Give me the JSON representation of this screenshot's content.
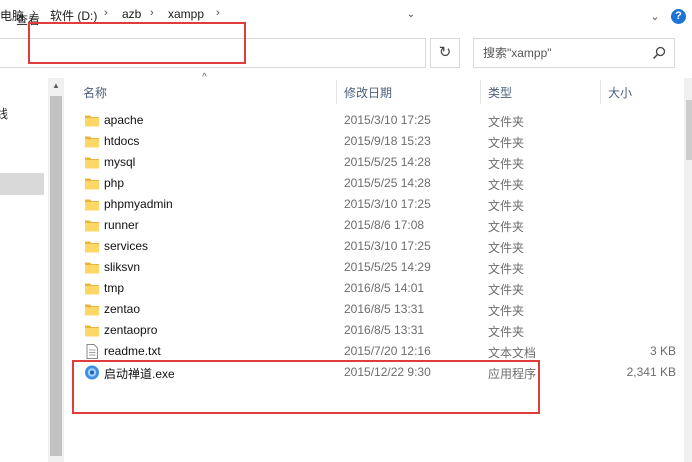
{
  "ribbon": {
    "tab_view": "查看",
    "expand_icon": "chevron-down-icon",
    "help_icon": "help-icon",
    "help_glyph": "?"
  },
  "address": {
    "crumbs": [
      "电脑",
      "软件 (D:)",
      "azb",
      "xampp"
    ],
    "separator": "›"
  },
  "search": {
    "placeholder": "搜索\"xampp\"",
    "icon": "search-icon"
  },
  "nav": {
    "partial_label": "线"
  },
  "columns": {
    "name": "名称",
    "date": "修改日期",
    "type": "类型",
    "size": "大小"
  },
  "files": [
    {
      "name": "apache",
      "date": "2015/3/10 17:25",
      "type": "文件夹",
      "size": "",
      "icon": "folder-icon"
    },
    {
      "name": "htdocs",
      "date": "2015/9/18 15:23",
      "type": "文件夹",
      "size": "",
      "icon": "folder-icon"
    },
    {
      "name": "mysql",
      "date": "2015/5/25 14:28",
      "type": "文件夹",
      "size": "",
      "icon": "folder-icon"
    },
    {
      "name": "php",
      "date": "2015/5/25 14:28",
      "type": "文件夹",
      "size": "",
      "icon": "folder-icon"
    },
    {
      "name": "phpmyadmin",
      "date": "2015/3/10 17:25",
      "type": "文件夹",
      "size": "",
      "icon": "folder-icon"
    },
    {
      "name": "runner",
      "date": "2015/8/6 17:08",
      "type": "文件夹",
      "size": "",
      "icon": "folder-icon"
    },
    {
      "name": "services",
      "date": "2015/3/10 17:25",
      "type": "文件夹",
      "size": "",
      "icon": "folder-icon"
    },
    {
      "name": "sliksvn",
      "date": "2015/5/25 14:29",
      "type": "文件夹",
      "size": "",
      "icon": "folder-icon"
    },
    {
      "name": "tmp",
      "date": "2016/8/5 14:01",
      "type": "文件夹",
      "size": "",
      "icon": "folder-icon"
    },
    {
      "name": "zentao",
      "date": "2016/8/5 13:31",
      "type": "文件夹",
      "size": "",
      "icon": "folder-icon"
    },
    {
      "name": "zentaopro",
      "date": "2016/8/5 13:31",
      "type": "文件夹",
      "size": "",
      "icon": "folder-icon"
    },
    {
      "name": "readme.txt",
      "date": "2015/7/20 12:16",
      "type": "文本文档",
      "size": "3 KB",
      "icon": "text-file-icon"
    },
    {
      "name": "启动禅道.exe",
      "date": "2015/12/22 9:30",
      "type": "应用程序",
      "size": "2,341 KB",
      "icon": "app-exe-icon"
    }
  ],
  "colors": {
    "folder": "#ffd767",
    "folder_dark": "#e8b53a",
    "accent": "#1c74d6",
    "annotation": "#e03c3c",
    "header_text": "#4c607a"
  }
}
